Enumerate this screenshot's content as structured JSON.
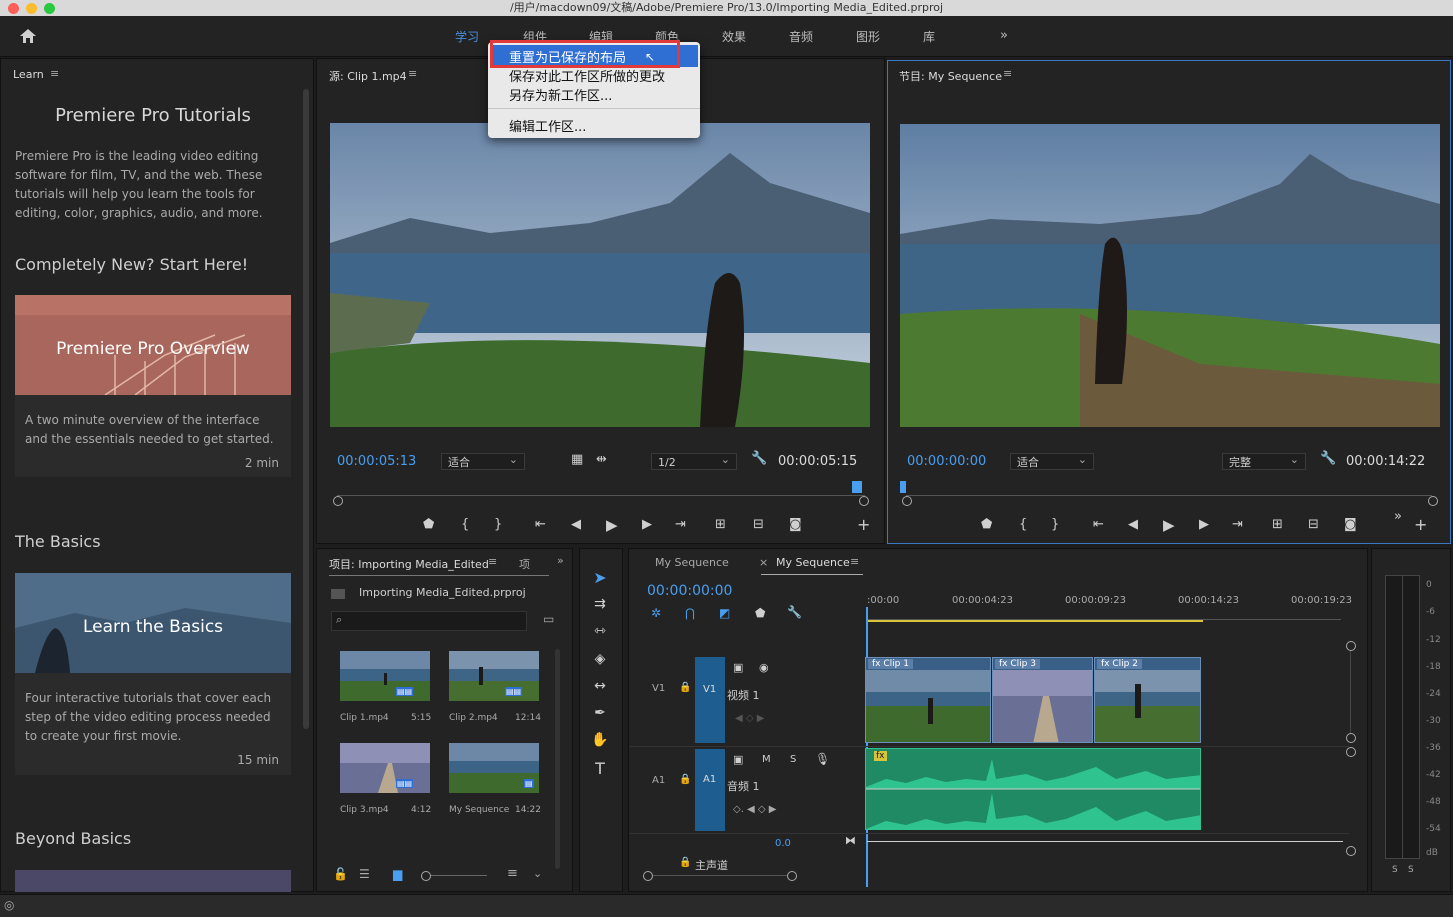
{
  "window": {
    "title": "/用户/macdown09/文稿/Adobe/Premiere Pro/13.0/Importing Media_Edited.prproj"
  },
  "workspaces": [
    {
      "label": "学习",
      "active": true
    },
    {
      "label": "组件"
    },
    {
      "label": "编辑"
    },
    {
      "label": "颜色"
    },
    {
      "label": "效果"
    },
    {
      "label": "音频"
    },
    {
      "label": "图形"
    },
    {
      "label": "库"
    }
  ],
  "workspace_menu": {
    "items": [
      "重置为已保存的布局",
      "保存对此工作区所做的更改",
      "另存为新工作区...",
      "编辑工作区..."
    ]
  },
  "learn": {
    "tab": "Learn",
    "heading": "Premiere Pro Tutorials",
    "intro": "Premiere Pro is the leading video editing software for film, TV, and the web. These tutorials will help you learn the tools for editing, color, graphics, audio, and more.",
    "sections": [
      {
        "title": "Completely New? Start Here!",
        "card_title": "Premiere Pro Overview",
        "desc": "A two minute overview of the interface and the essentials needed to get started.",
        "time": "2 min"
      },
      {
        "title": "The Basics",
        "card_title": "Learn the Basics",
        "desc": "Four interactive tutorials that cover each step of the video editing process needed to create your first movie.",
        "time": "15 min"
      },
      {
        "title": "Beyond Basics"
      }
    ]
  },
  "source": {
    "tab": "源: Clip 1.mp4",
    "timecode": "00:00:05:13",
    "fit": "适合",
    "resolution": "1/2",
    "duration": "00:00:05:15"
  },
  "program": {
    "tab": "节目: My Sequence",
    "timecode": "00:00:00:00",
    "fit": "适合",
    "quality": "完整",
    "duration": "00:00:14:22"
  },
  "project": {
    "tab": "项目: Importing Media_Edited",
    "tab2": "项",
    "file": "Importing Media_Edited.prproj",
    "items": [
      {
        "name": "Clip 1.mp4",
        "dur": "5:15"
      },
      {
        "name": "Clip 2.mp4",
        "dur": "12:14"
      },
      {
        "name": "Clip 3.mp4",
        "dur": "4:12"
      },
      {
        "name": "My Sequence",
        "dur": "14:22"
      }
    ]
  },
  "timeline": {
    "tab_inactive": "My Sequence",
    "tab_active": "My Sequence",
    "timecode": "00:00:00:00",
    "ruler": [
      ":00:00",
      "00:00:04:23",
      "00:00:09:23",
      "00:00:14:23",
      "00:00:19:23"
    ],
    "v1": {
      "label": "V1",
      "name": "视频 1"
    },
    "a1": {
      "label": "A1",
      "name": "音频 1",
      "m": "M",
      "s": "S"
    },
    "master": {
      "name": "主声道",
      "value": "0.0"
    },
    "clips": [
      "Clip 1",
      "Clip 3",
      "Clip 2"
    ],
    "fx": "fx"
  },
  "meter": {
    "ticks": [
      "0",
      "-6",
      "-12",
      "-18",
      "-24",
      "-30",
      "-36",
      "-42",
      "-48",
      "-54",
      "dB"
    ],
    "s": [
      "S",
      "S"
    ]
  },
  "colors": {
    "accent": "#4a9ef0",
    "audio": "#2fc48f",
    "highlight": "#2f6ed3",
    "redbox": "#e23a3a"
  }
}
